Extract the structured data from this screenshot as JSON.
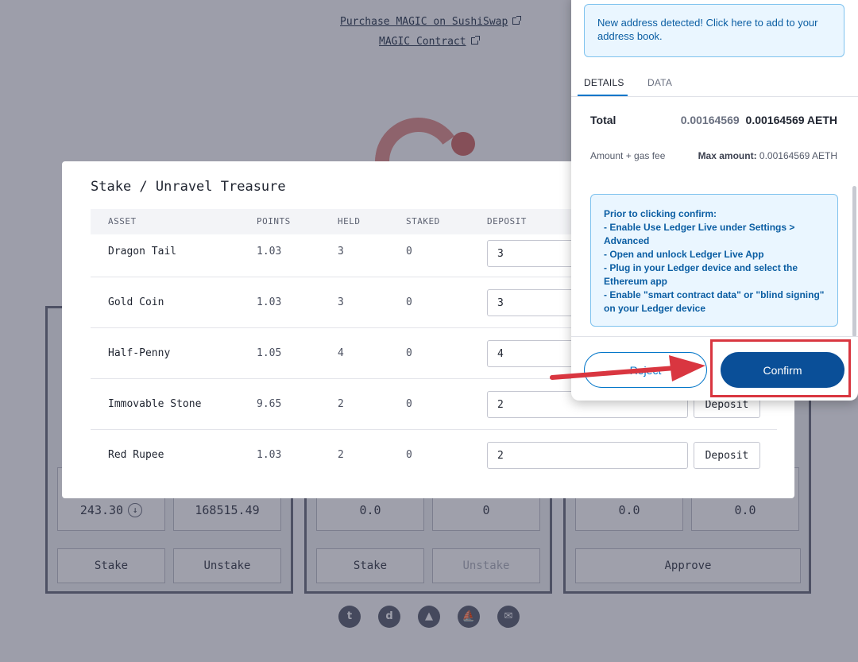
{
  "background": {
    "links": {
      "sushiswap": "Purchase MAGIC on SushiSwap",
      "contract": "MAGIC Contract"
    },
    "cards": [
      {
        "stats": [
          "243.30",
          "168515.49"
        ],
        "buttons": [
          "Stake",
          "Unstake"
        ]
      },
      {
        "stats": [
          "0.0",
          "0"
        ],
        "buttons": [
          "Stake",
          "Unstake"
        ]
      },
      {
        "stats": [
          "0.0",
          "0.0"
        ],
        "buttons": [
          "Approve"
        ]
      }
    ],
    "socials": [
      "twitter-icon",
      "discord-icon",
      "chart-icon",
      "boat-icon",
      "mail-icon"
    ]
  },
  "stake_modal": {
    "title": "Stake / Unravel Treasure",
    "headers": {
      "asset": "ASSET",
      "points": "POINTS",
      "held": "HELD",
      "staked": "STAKED",
      "deposit": "DEPOSIT"
    },
    "rows": [
      {
        "asset": "Dragon Tail",
        "points": "1.03",
        "held": "3",
        "staked": "0",
        "deposit": "3"
      },
      {
        "asset": "Gold Coin",
        "points": "1.03",
        "held": "3",
        "staked": "0",
        "deposit": "3"
      },
      {
        "asset": "Half-Penny",
        "points": "1.05",
        "held": "4",
        "staked": "0",
        "deposit": "4"
      },
      {
        "asset": "Immovable Stone",
        "points": "9.65",
        "held": "2",
        "staked": "0",
        "deposit": "2"
      },
      {
        "asset": "Red Rupee",
        "points": "1.03",
        "held": "2",
        "staked": "0",
        "deposit": "2"
      }
    ],
    "deposit_button_label": "Deposit"
  },
  "wallet": {
    "new_address_notice": "New address detected! Click here to add to your address book.",
    "tabs": {
      "details": "DETAILS",
      "data": "DATA"
    },
    "total_label": "Total",
    "total_fiat": "0.00164569",
    "total_crypto": "0.00164569 AETH",
    "amount_gas_label": "Amount + gas fee",
    "max_amount_label": "Max amount:",
    "max_amount_value": "0.00164569 AETH",
    "ledger_instructions": [
      "Prior to clicking confirm:",
      "- Enable Use Ledger Live under Settings > Advanced",
      "- Open and unlock Ledger Live App",
      "- Plug in your Ledger device and select the Ethereum app",
      "- Enable \"smart contract data\" or \"blind signing\" on your Ledger device"
    ],
    "reject_label": "Reject",
    "confirm_label": "Confirm"
  },
  "annotation_colors": {
    "highlight": "#d93640",
    "arrow": "#d93640"
  }
}
